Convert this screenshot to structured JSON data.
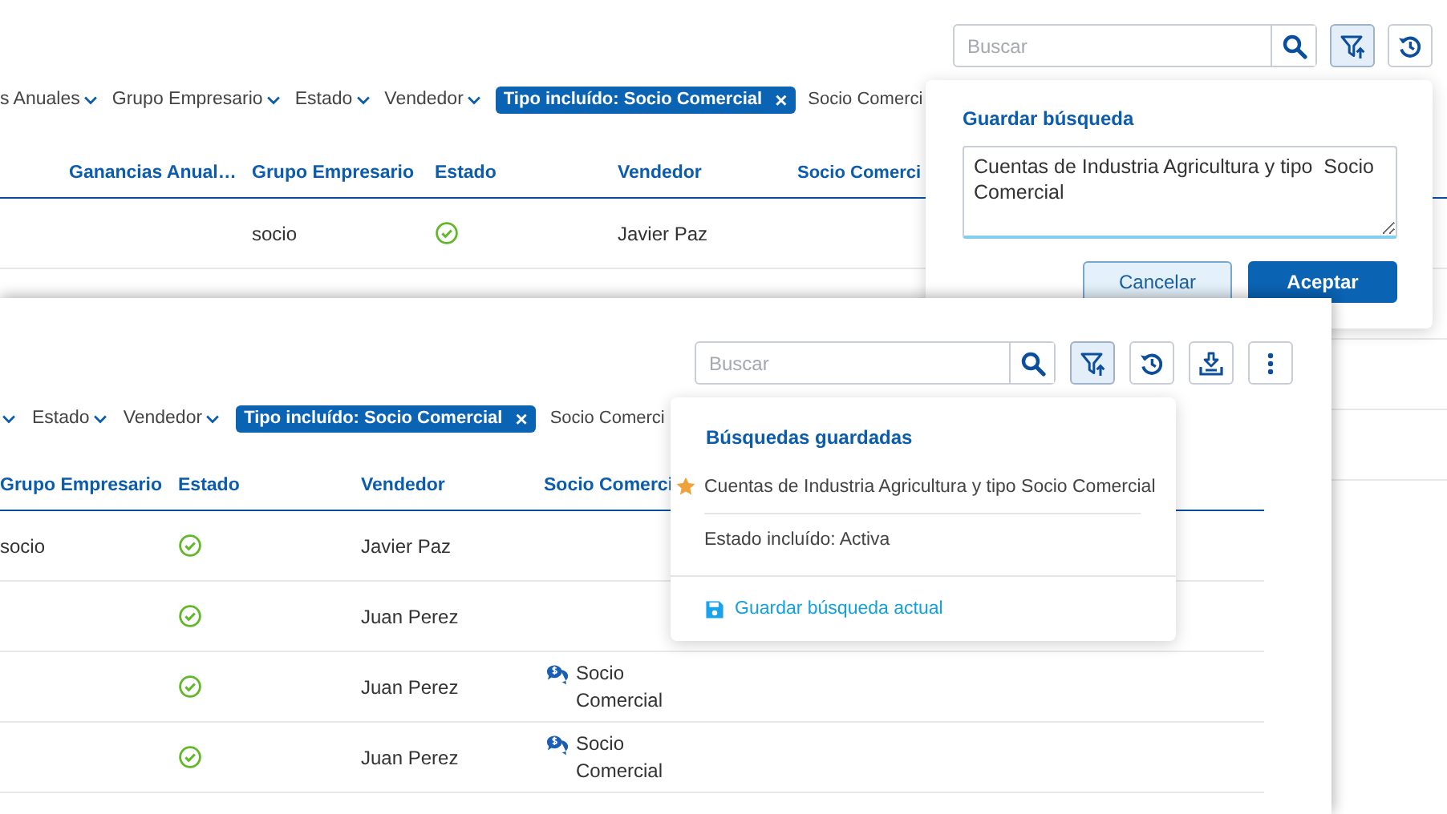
{
  "back_window": {
    "search": {
      "placeholder": "Buscar"
    },
    "toolbar_buttons": [
      {
        "kind": "filter",
        "selected": true
      },
      {
        "kind": "history",
        "selected": false
      }
    ],
    "filters": [
      {
        "kind": "dropdown",
        "label": "s Anuales"
      },
      {
        "kind": "dropdown",
        "label": "Grupo Empresario"
      },
      {
        "kind": "dropdown",
        "label": "Estado"
      },
      {
        "kind": "dropdown",
        "label": "Vendedor"
      },
      {
        "kind": "chip",
        "label": "Tipo incluído: Socio Comercial",
        "close": "×"
      },
      {
        "kind": "text",
        "label": "Socio Comerci"
      }
    ],
    "table": {
      "columns": [
        "Ganancias Anual…",
        "Grupo Empresario",
        "Estado",
        "Vendedor",
        "Socio Comerci"
      ],
      "rows": [
        {
          "grupo_empresario": "socio",
          "active": true,
          "vendedor": "Javier Paz"
        }
      ]
    },
    "save_dialog": {
      "title": "Guardar búsqueda",
      "value": "Cuentas de Industria Agricultura y tipo  Socio Comercial",
      "buttons": [
        {
          "kind": "secondary",
          "label": "Cancelar"
        },
        {
          "kind": "primary",
          "label": "Aceptar"
        }
      ]
    }
  },
  "front_window": {
    "search": {
      "placeholder": "Buscar"
    },
    "toolbar_buttons": [
      {
        "kind": "filter",
        "selected": true
      },
      {
        "kind": "history",
        "selected": false
      },
      {
        "kind": "download",
        "selected": false
      },
      {
        "kind": "more",
        "selected": false
      }
    ],
    "filters": [
      {
        "kind": "caret"
      },
      {
        "kind": "dropdown",
        "label": "Estado"
      },
      {
        "kind": "dropdown",
        "label": "Vendedor"
      },
      {
        "kind": "chip",
        "label": "Tipo incluído: Socio Comercial",
        "close": "×"
      },
      {
        "kind": "text",
        "label": "Socio Comerci"
      }
    ],
    "table": {
      "columns": [
        "Grupo Empresario",
        "Estado",
        "Vendedor",
        "Socio Comerci"
      ],
      "rows": [
        {
          "grupo_empresario": "socio",
          "active": true,
          "vendedor": "Javier Paz"
        },
        {
          "active": true,
          "vendedor": "Juan Perez"
        },
        {
          "active": true,
          "vendedor": "Juan Perez",
          "socio_comercial": "Socio Comercial"
        },
        {
          "active": true,
          "vendedor": "Juan Perez",
          "socio_comercial": "Socio Comercial"
        }
      ]
    },
    "saved_searches": {
      "title": "Búsquedas guardadas",
      "items": [
        {
          "label": "Cuentas de Industria Agricultura y tipo Socio Comercial",
          "favorite": true
        },
        {
          "label": "Estado incluído: Activa",
          "favorite": false
        }
      ],
      "action": "Guardar búsqueda actual"
    }
  }
}
